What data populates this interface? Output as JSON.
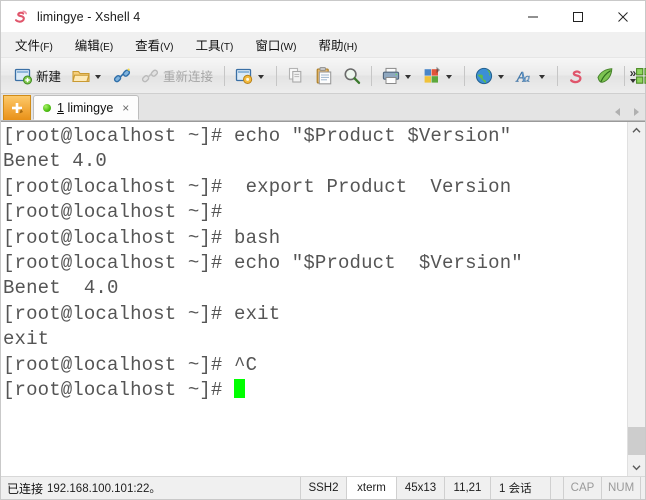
{
  "window": {
    "title": "limingye - Xshell 4",
    "app_icon": "xshell-logo-icon",
    "minimize_label": "—",
    "maximize_label": "□",
    "close_label": "✕"
  },
  "menubar": {
    "items": [
      {
        "name": "file",
        "label": "文件",
        "mnemonic": "(F)"
      },
      {
        "name": "edit",
        "label": "编辑",
        "mnemonic": "(E)"
      },
      {
        "name": "view",
        "label": "查看",
        "mnemonic": "(V)"
      },
      {
        "name": "tools",
        "label": "工具",
        "mnemonic": "(T)"
      },
      {
        "name": "window",
        "label": "窗口",
        "mnemonic": "(W)"
      },
      {
        "name": "help",
        "label": "帮助",
        "mnemonic": "(H)"
      }
    ]
  },
  "toolbar": {
    "new_label": "新建",
    "reconnect_label": "重新连接",
    "overflow_label": "»",
    "icons": {
      "new": "new-session-icon",
      "open": "open-folder-icon",
      "connect": "connect-plug-icon",
      "reconnect": "reconnect-plug-icon",
      "properties": "session-properties-icon",
      "copy": "copy-icon",
      "paste": "paste-icon",
      "find": "find-magnifier-icon",
      "print": "print-icon",
      "transfer": "file-transfer-icon",
      "browser": "web-browser-icon",
      "font": "font-icon",
      "xshell": "xshell-icon",
      "xftp": "xftp-icon",
      "arrange": "arrange-windows-icon"
    }
  },
  "tabbar": {
    "new_tab_label": "+",
    "tabs": [
      {
        "number": "1",
        "label": "limingye",
        "status": "connected",
        "close_label": "×"
      }
    ],
    "nav_prev": "scroll-tabs-left",
    "nav_next": "scroll-tabs-right"
  },
  "terminal": {
    "lines": [
      "[root@localhost ~]# echo \"$Product $Version\"",
      "Benet 4.0",
      "[root@localhost ~]#  export Product  Version",
      "[root@localhost ~]#",
      "[root@localhost ~]# bash",
      "[root@localhost ~]# echo \"$Product  $Version\"",
      "Benet  4.0",
      "[root@localhost ~]# exit",
      "exit",
      "[root@localhost ~]# ^C",
      "[root@localhost ~]# "
    ],
    "cursor_line_index": 10,
    "foreground_color": "#555555",
    "background_color": "#ffffff",
    "cursor_color": "#00ff00"
  },
  "statusbar": {
    "connection_label": "已连接",
    "connection_address": "192.168.100.101:22。",
    "protocol": "SSH2",
    "term_type": "xterm",
    "dimensions": "45x13",
    "cursor_position": "11,21",
    "sessions": "1 会话",
    "caps_lock": "CAP",
    "num_lock": "NUM"
  }
}
